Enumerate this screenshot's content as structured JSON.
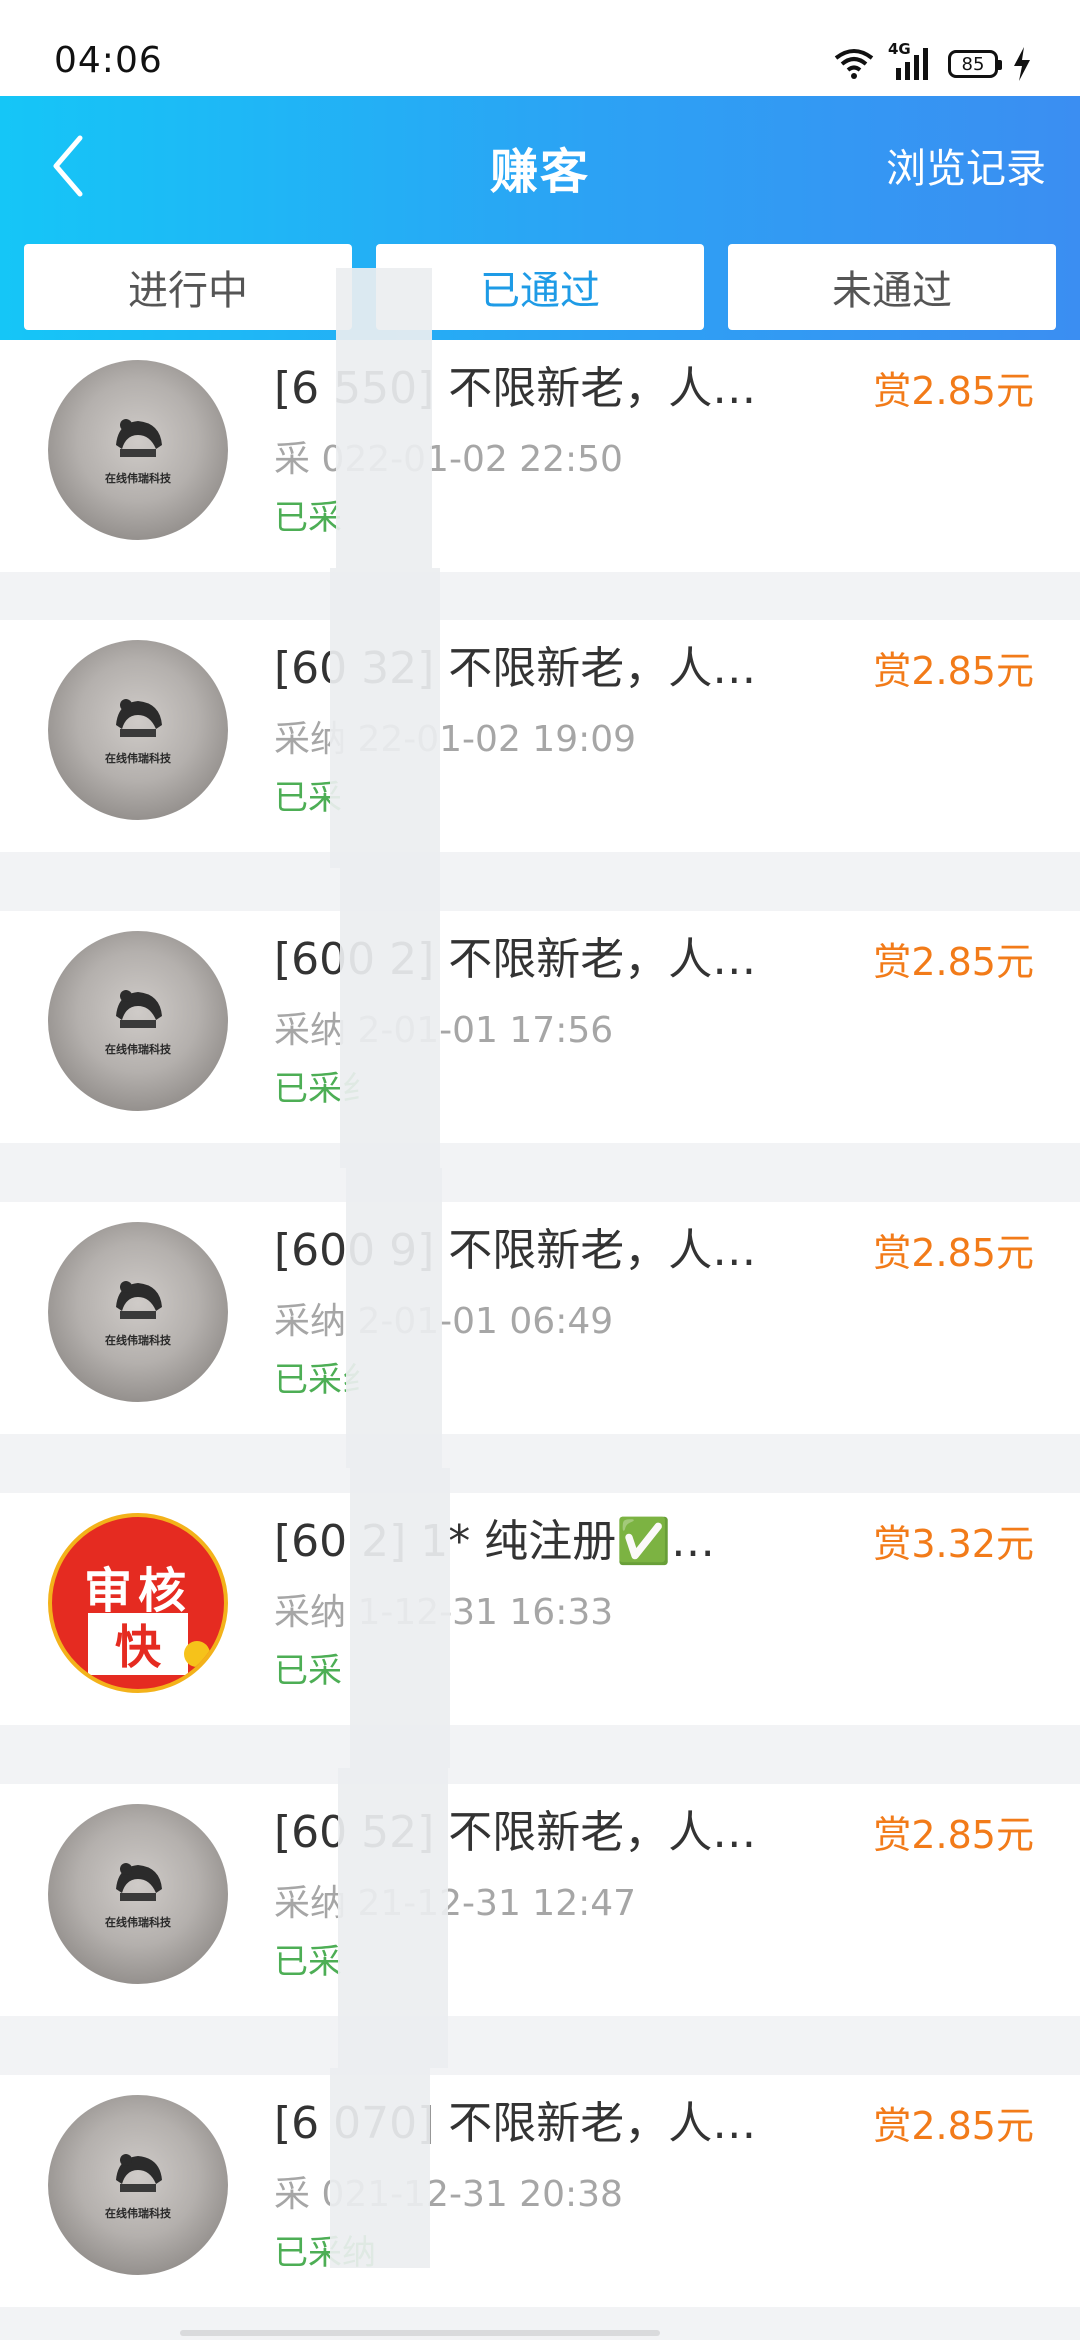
{
  "status_bar": {
    "time": "04:06",
    "network_label": "4G",
    "battery_level": "85",
    "charging": true
  },
  "header": {
    "title": "赚客",
    "back_icon": "chevron-left-icon",
    "history_label": "浏览记录",
    "colors": {
      "gradient_start": "#15c6f7",
      "gradient_end": "#3b8ef2"
    }
  },
  "tabs": [
    {
      "label": "进行中",
      "active": false
    },
    {
      "label": "已通过",
      "active": true
    },
    {
      "label": "未通过",
      "active": false
    }
  ],
  "accent_colors": {
    "reward": "#f27b19",
    "status": "#4dae55",
    "active_tab": "#1e9be6"
  },
  "items": [
    {
      "title": "[6 550] 不限新老，人…",
      "date": "采 022-01-02 22:50",
      "status": "已采",
      "reward": "赏2.85元",
      "avatar": "logo-avatar"
    },
    {
      "title": "[60 32] 不限新老，人…",
      "date": "采纳 22-01-02 19:09",
      "status": "已采",
      "reward": "赏2.85元",
      "avatar": "logo-avatar"
    },
    {
      "title": "[600 2] 不限新老，人…",
      "date": "采纳 2-01-01 17:56",
      "status": "已采纟",
      "reward": "赏2.85元",
      "avatar": "logo-avatar"
    },
    {
      "title": "[600 9] 不限新老，人…",
      "date": "采纳 2-01-01 06:49",
      "status": "已采纟",
      "reward": "赏2.85元",
      "avatar": "logo-avatar"
    },
    {
      "title": "[60 2] 1* 纯注册✅…",
      "date": "采纳 1-12-31 16:33",
      "status": "已采",
      "reward": "赏3.32元",
      "avatar": "fast-review-avatar",
      "avatar_top": "审核",
      "avatar_bottom": "快"
    },
    {
      "title": "[60 52] 不限新老，人…",
      "date": "采纳 21-12-31 12:47",
      "status": "已采",
      "reward": "赏2.85元",
      "avatar": "logo-avatar"
    },
    {
      "title": "[6 070] 不限新老，人…",
      "date": "采 021-12-31 20:38",
      "status": "已采纳",
      "reward": "赏2.85元",
      "avatar": "logo-avatar"
    }
  ],
  "avatar_logo_text": "在线伟瑞科技"
}
